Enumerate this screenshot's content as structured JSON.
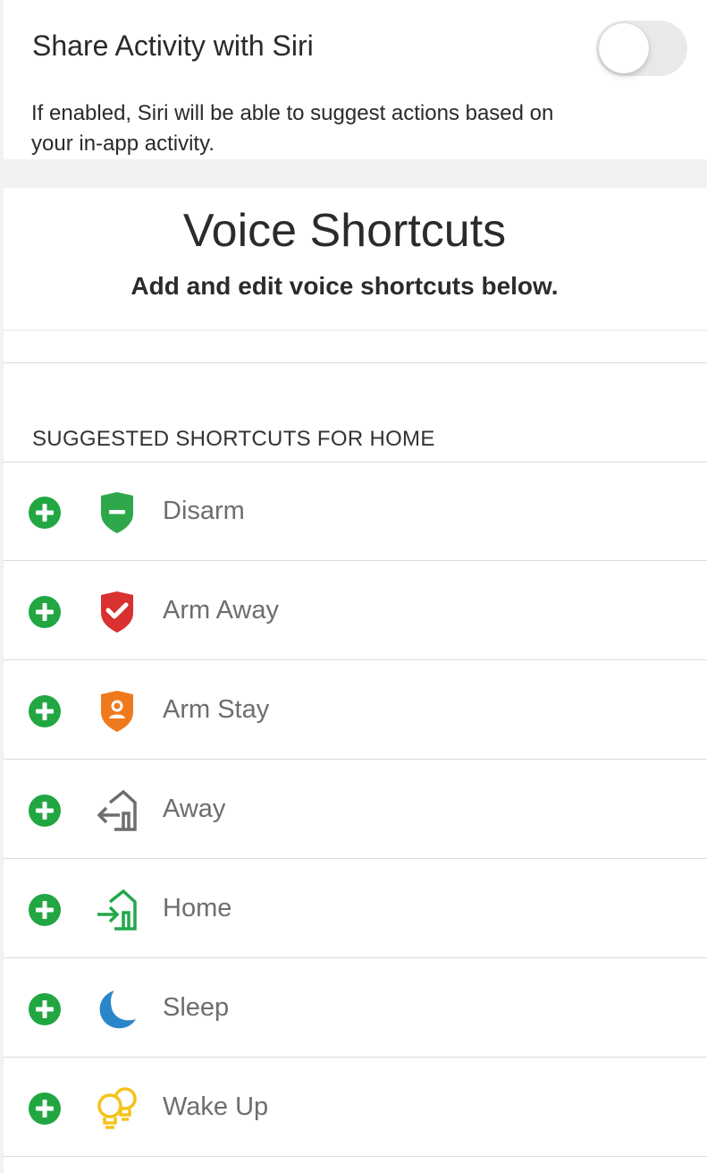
{
  "siri": {
    "title": "Share Activity with Siri",
    "toggle_on": false,
    "description": "If enabled, Siri will be able to suggest actions based on your in-app activity."
  },
  "voice_shortcuts": {
    "title": "Voice Shortcuts",
    "subtitle": "Add and edit voice shortcuts below."
  },
  "section": {
    "header": "SUGGESTED SHORTCUTS FOR HOME"
  },
  "shortcuts": [
    {
      "label": "Disarm",
      "icon": "shield-minus-icon",
      "color": "#2ea84a"
    },
    {
      "label": "Arm Away",
      "icon": "shield-check-icon",
      "color": "#d93030"
    },
    {
      "label": "Arm Stay",
      "icon": "shield-person-icon",
      "color": "#ef7a1e"
    },
    {
      "label": "Away",
      "icon": "leave-home-icon",
      "color": "#6d6d72"
    },
    {
      "label": "Home",
      "icon": "enter-home-icon",
      "color": "#22a84a"
    },
    {
      "label": "Sleep",
      "icon": "moon-icon",
      "color": "#2a86c8"
    },
    {
      "label": "Wake Up",
      "icon": "lightbulbs-icon",
      "color": "#f4c21a"
    }
  ],
  "colors": {
    "add_button": "#21a642",
    "toggle_off": "#e9e9eb",
    "label": "#6d6d72"
  }
}
